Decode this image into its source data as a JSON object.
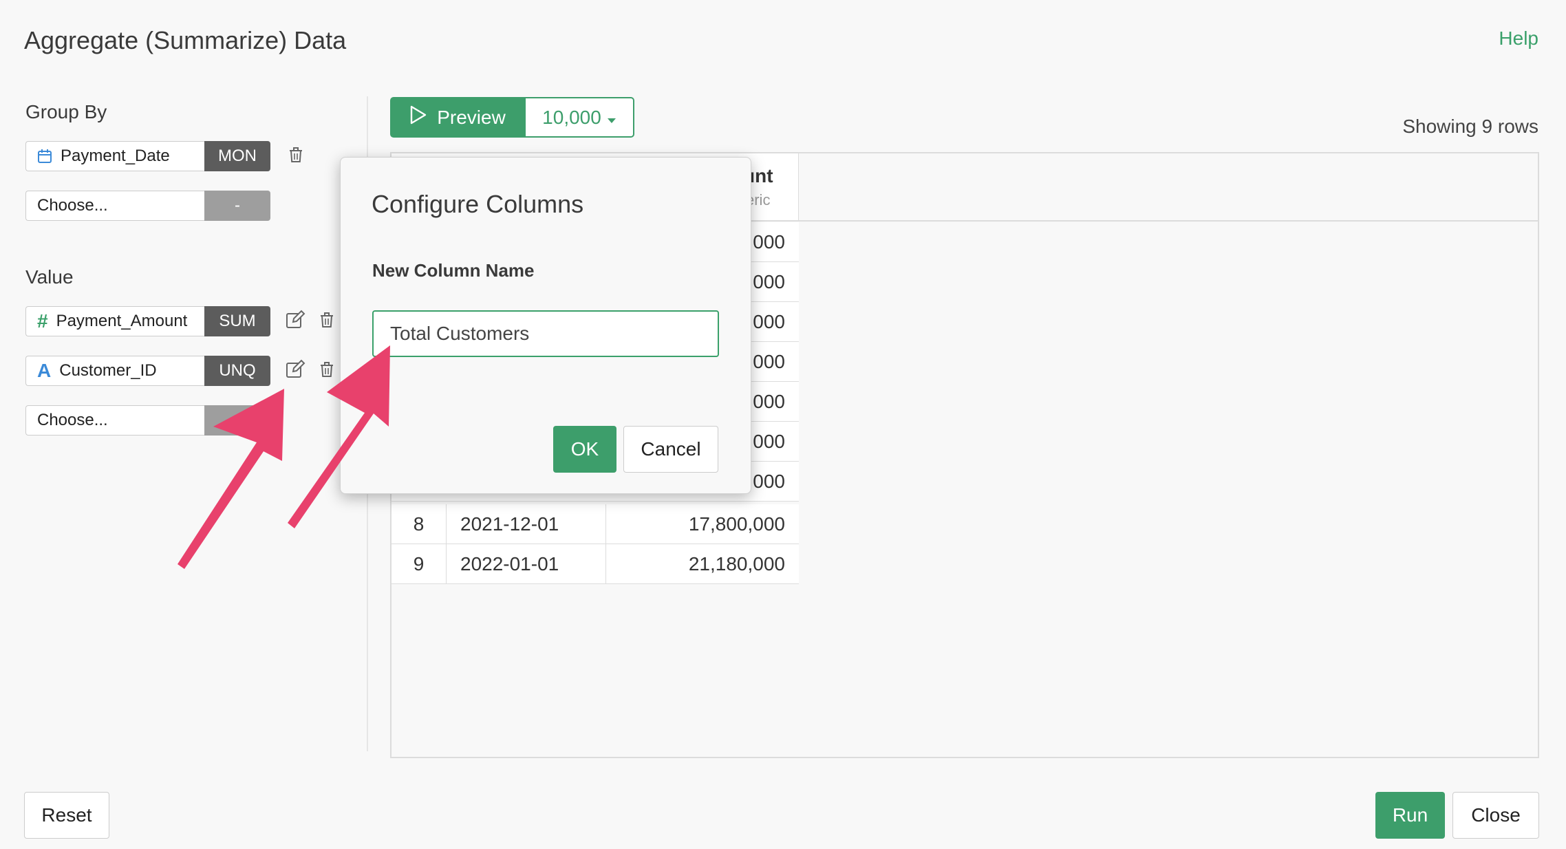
{
  "header": {
    "title": "Aggregate (Summarize) Data",
    "help": "Help"
  },
  "group_by": {
    "label": "Group By",
    "rows": [
      {
        "field": "Payment_Date",
        "type_icon": "calendar-icon",
        "agg": "MON"
      },
      {
        "field": "Choose...",
        "agg": "-"
      }
    ]
  },
  "value": {
    "label": "Value",
    "rows": [
      {
        "field": "Payment_Amount",
        "type_icon": "hash-icon",
        "agg": "SUM"
      },
      {
        "field": "Customer_ID",
        "type_icon": "text-type-icon",
        "agg": "UNQ"
      },
      {
        "field": "Choose..."
      }
    ]
  },
  "preview": {
    "label": "Preview",
    "rows": "10,000",
    "showing": "Showing 9 rows"
  },
  "table": {
    "amount_header": "unt",
    "amount_subtype": "eric",
    "hidden_values": [
      "000",
      "000",
      "000",
      "000",
      "000",
      "000",
      "000"
    ],
    "rows": [
      {
        "num": "8",
        "date": "2021-12-01",
        "amount": "17,800,000"
      },
      {
        "num": "9",
        "date": "2022-01-01",
        "amount": "21,180,000"
      }
    ]
  },
  "modal": {
    "title": "Configure Columns",
    "label": "New Column Name",
    "input_value": "Total Customers",
    "ok": "OK",
    "cancel": "Cancel"
  },
  "footer": {
    "reset": "Reset",
    "run": "Run",
    "close": "Close"
  },
  "colors": {
    "accent": "#3d9e6b",
    "annotation": "#e8416c"
  }
}
